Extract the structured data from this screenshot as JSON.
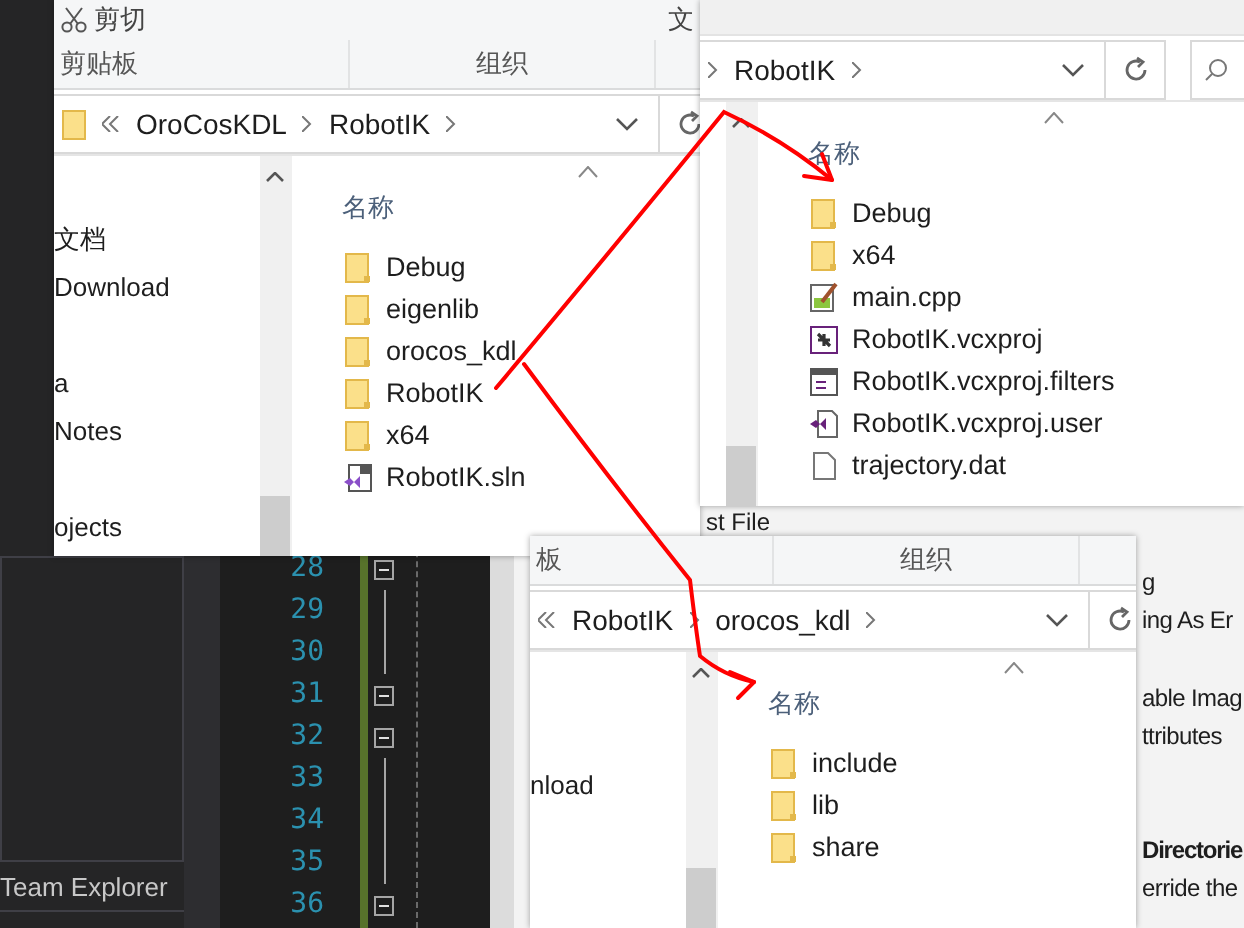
{
  "editor": {
    "line_numbers": [
      {
        "number": "28",
        "foldable": true
      },
      {
        "number": "29",
        "foldable": false
      },
      {
        "number": "30",
        "foldable": false
      },
      {
        "number": "31",
        "foldable": true
      },
      {
        "number": "32",
        "foldable": true
      },
      {
        "number": "33",
        "foldable": false
      },
      {
        "number": "34",
        "foldable": false
      },
      {
        "number": "35",
        "foldable": false
      },
      {
        "number": "36",
        "foldable": true
      }
    ]
  },
  "team_explorer_tab": "Team Explorer",
  "properties": {
    "fragment": "st File",
    "groups": [
      [
        {
          "text": "g",
          "kind": "row"
        },
        {
          "text": "ing As Er",
          "kind": "row"
        }
      ],
      [
        {
          "text": "able Imag",
          "kind": "row"
        },
        {
          "text": "ttributes",
          "kind": "row"
        }
      ],
      [
        {
          "text": "Directorie",
          "kind": "heading"
        },
        {
          "text": "erride the",
          "kind": "row"
        }
      ]
    ]
  },
  "windows": [
    {
      "ribbon": {
        "cut_label": "剪切",
        "tail_fragment": "文",
        "groups": [
          "剪贴板",
          "组织"
        ]
      },
      "breadcrumb": [
        "OroCosKDL",
        "RobotIK"
      ],
      "nav_groups": [
        [
          "文档",
          "Download"
        ],
        [
          "a",
          "Notes"
        ],
        [
          "ojects"
        ]
      ],
      "column_header": "名称",
      "files": [
        {
          "name": "Debug",
          "kind": "folder"
        },
        {
          "name": "eigenlib",
          "kind": "folder"
        },
        {
          "name": "orocos_kdl",
          "kind": "folder"
        },
        {
          "name": "RobotIK",
          "kind": "folder"
        },
        {
          "name": "x64",
          "kind": "folder"
        },
        {
          "name": "RobotIK.sln",
          "kind": "sln"
        }
      ]
    },
    {
      "breadcrumb": [
        "RobotIK"
      ],
      "column_header": "名称",
      "files": [
        {
          "name": "Debug",
          "kind": "folder"
        },
        {
          "name": "x64",
          "kind": "folder"
        },
        {
          "name": "main.cpp",
          "kind": "cpp"
        },
        {
          "name": "RobotIK.vcxproj",
          "kind": "vcxproj"
        },
        {
          "name": "RobotIK.vcxproj.filters",
          "kind": "filters"
        },
        {
          "name": "RobotIK.vcxproj.user",
          "kind": "user"
        },
        {
          "name": "trajectory.dat",
          "kind": "dat"
        }
      ]
    },
    {
      "ribbon": {
        "groups": [
          "板",
          "组织"
        ]
      },
      "breadcrumb": [
        "RobotIK",
        "orocos_kdl"
      ],
      "nav_groups": [
        [
          "nload"
        ]
      ],
      "column_header": "名称",
      "files": [
        {
          "name": "include",
          "kind": "folder"
        },
        {
          "name": "lib",
          "kind": "folder"
        },
        {
          "name": "share",
          "kind": "folder"
        }
      ]
    }
  ]
}
